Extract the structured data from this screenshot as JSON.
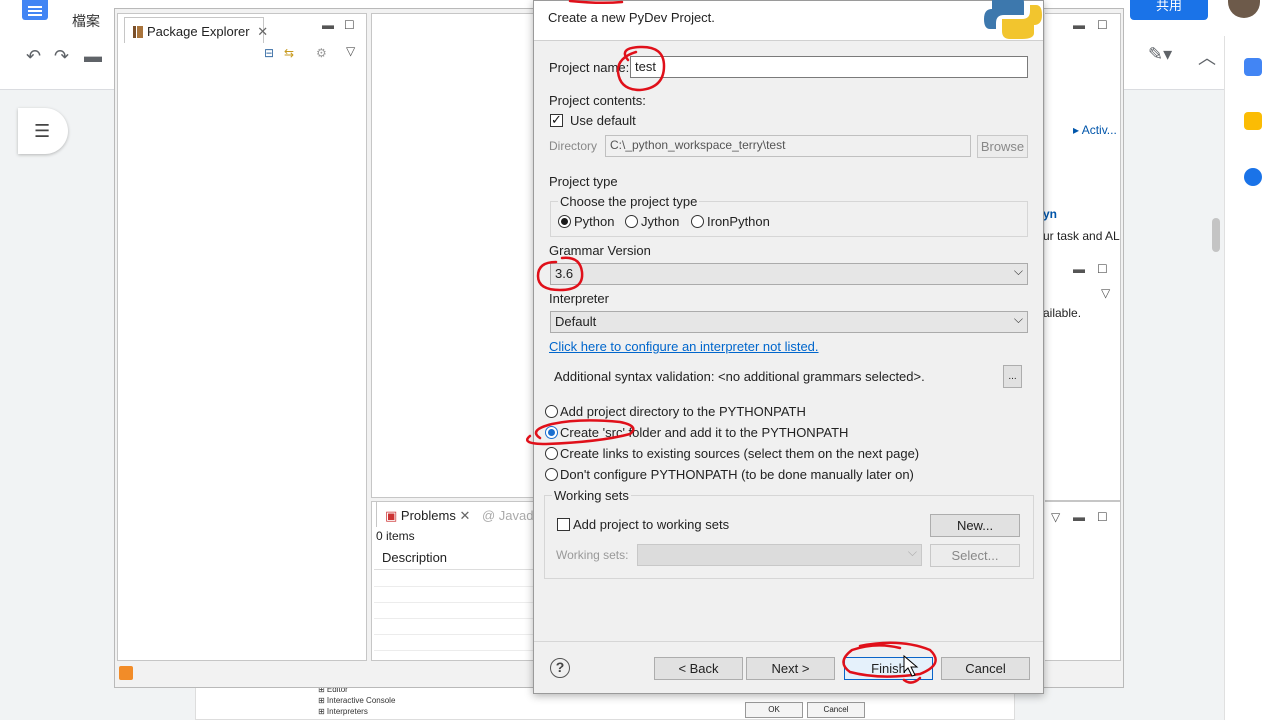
{
  "gdocs": {
    "menu_file": "檔案",
    "share_label": "共用"
  },
  "eclipse": {
    "package_explorer_tab": "Package Explorer",
    "problems_tab": "Problems",
    "javadoc_tab": "@ Javado",
    "problems_count": "0 items",
    "problems_description_header": "Description",
    "right_link_1": "▸  Activ...",
    "right_link_2": "yn",
    "right_text_1": "ur task and AL",
    "right_text_2": "ailable."
  },
  "dialog": {
    "subtitle": "Create a new PyDev Project.",
    "project_name_label": "Project name:",
    "project_name_value": "test",
    "project_contents_label": "Project contents:",
    "use_default_label": "Use default",
    "use_default_checked": true,
    "directory_label": "Directory",
    "directory_value": "C:\\_python_workspace_terry\\test",
    "browse_label": "Browse",
    "project_type_label": "Project type",
    "choose_project_type_label": "Choose the project type",
    "project_types": [
      {
        "label": "Python",
        "selected": true
      },
      {
        "label": "Jython",
        "selected": false
      },
      {
        "label": "IronPython",
        "selected": false
      }
    ],
    "grammar_version_label": "Grammar Version",
    "grammar_version_value": "3.6",
    "interpreter_label": "Interpreter",
    "interpreter_value": "Default",
    "configure_interpreter_link": "Click here to configure an interpreter not listed.",
    "additional_syntax_label": "Additional syntax validation: <no additional grammars selected>.",
    "additional_syntax_button": "...",
    "pythonpath_options": [
      {
        "label": "Add project directory to the PYTHONPATH",
        "selected": false
      },
      {
        "label": "Create 'src' folder and add it to the PYTHONPATH",
        "selected": true
      },
      {
        "label": "Create links to existing sources (select them on the next page)",
        "selected": false
      },
      {
        "label": "Don't configure PYTHONPATH (to be done manually later on)",
        "selected": false
      }
    ],
    "working_sets_label": "Working sets",
    "add_to_working_sets_label": "Add project to working sets",
    "add_to_working_sets_checked": false,
    "new_button": "New...",
    "working_sets_field_label": "Working sets:",
    "working_sets_value": "",
    "select_button": "Select...",
    "back_button": "< Back",
    "next_button": "Next >",
    "finish_button": "Finish",
    "cancel_button": "Cancel"
  },
  "colors": {
    "annotation_red": "#e0101a",
    "link_blue": "#0066cc",
    "share_blue": "#1a73e8"
  },
  "icons": [
    "docs-logo-icon",
    "undo-icon",
    "redo-icon",
    "print-icon",
    "outline-icon",
    "pencil-icon",
    "chevron-up-icon",
    "calendar-icon",
    "keep-icon",
    "tasks-icon",
    "python-logo-icon",
    "help-icon",
    "rss-icon",
    "close-icon",
    "minimize-icon",
    "maximize-icon",
    "view-menu-icon"
  ]
}
